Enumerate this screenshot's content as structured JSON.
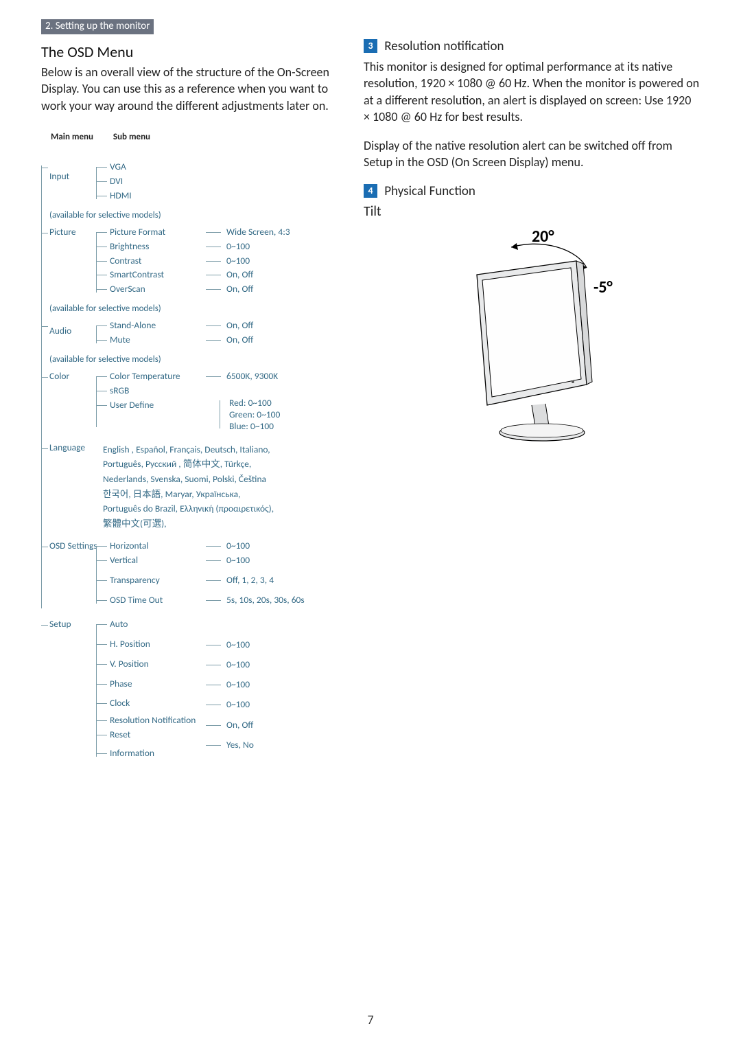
{
  "chapter_bar": "2. Setting up the monitor",
  "left": {
    "title": "The OSD Menu",
    "intro": "Below is an overall view of the structure of the On-Screen Display. You can use this as a reference when you want to work your way around the different adjustments later on.",
    "headers": {
      "main": "Main menu",
      "sub": "Sub menu"
    },
    "note_selective": "(available for selective models)",
    "tree": {
      "input": {
        "label": "Input",
        "items": [
          "VGA",
          "DVI",
          "HDMI"
        ]
      },
      "picture": {
        "label": "Picture",
        "items": [
          {
            "sub": "Picture Format",
            "val": "Wide Screen, 4:3"
          },
          {
            "sub": "Brightness",
            "val": "0~100"
          },
          {
            "sub": "Contrast",
            "val": "0~100"
          },
          {
            "sub": "SmartContrast",
            "val": "On, Off"
          },
          {
            "sub": "OverScan",
            "val": "On, Off"
          }
        ]
      },
      "audio": {
        "label": "Audio",
        "items": [
          {
            "sub": "Stand-Alone",
            "val": "On, Off"
          },
          {
            "sub": "Mute",
            "val": "On, Off"
          }
        ]
      },
      "color": {
        "label": "Color",
        "items": [
          {
            "sub": "Color Temperature",
            "val": "6500K, 9300K"
          },
          {
            "sub": "sRGB",
            "val": ""
          },
          {
            "sub": "User Define",
            "vals": [
              "Red: 0~100",
              "Green: 0~100",
              "Blue: 0~100"
            ]
          }
        ]
      },
      "language": {
        "label": "Language",
        "lines": [
          "English , Español, Français, Deutsch, Italiano,",
          "Português, Русский , 简体中文, Türkçe,",
          "Nederlands, Svenska, Suomi, Polski, Čeština",
          "한국어, 日本語, Maryar, Українська,",
          "Português do Brazil, Ελληνική (προαιρετικός),",
          "繁體中文(可選),"
        ]
      },
      "osd": {
        "label": "OSD Settings",
        "items": [
          {
            "sub": "Horizontal",
            "val": "0~100"
          },
          {
            "sub": "Vertical",
            "val": "0~100"
          },
          {
            "sub": "Transparency",
            "val": "Off, 1, 2, 3, 4"
          },
          {
            "sub": "OSD Time Out",
            "val": "5s, 10s, 20s, 30s, 60s"
          }
        ]
      },
      "setup": {
        "label": "Setup",
        "items": [
          {
            "sub": "Auto",
            "val": ""
          },
          {
            "sub": "H. Position",
            "val": "0~100"
          },
          {
            "sub": "V. Position",
            "val": "0~100"
          },
          {
            "sub": "Phase",
            "val": "0~100"
          },
          {
            "sub": "Clock",
            "val": "0~100"
          },
          {
            "sub": "Resolution Notification",
            "val": "On, Off"
          },
          {
            "sub": "Reset",
            "val": "Yes, No"
          },
          {
            "sub": "Information",
            "val": ""
          }
        ]
      }
    }
  },
  "right": {
    "num3": "3",
    "sec3_title": "Resolution notification",
    "sec3_p1": "This monitor is designed for optimal performance at its native resolution, 1920 × 1080 @ 60 Hz. When the monitor is powered on at a different resolution, an alert is displayed on screen: Use 1920 × 1080 @ 60 Hz for best results.",
    "sec3_p2": "Display of the native resolution alert can be switched off from Setup in the OSD (On Screen Display) menu.",
    "num4": "4",
    "sec4_title": "Physical Function",
    "tilt_label": "Tilt",
    "tilt_angle_back": "20°",
    "tilt_angle_fwd": "-5°"
  },
  "page_number": "7"
}
